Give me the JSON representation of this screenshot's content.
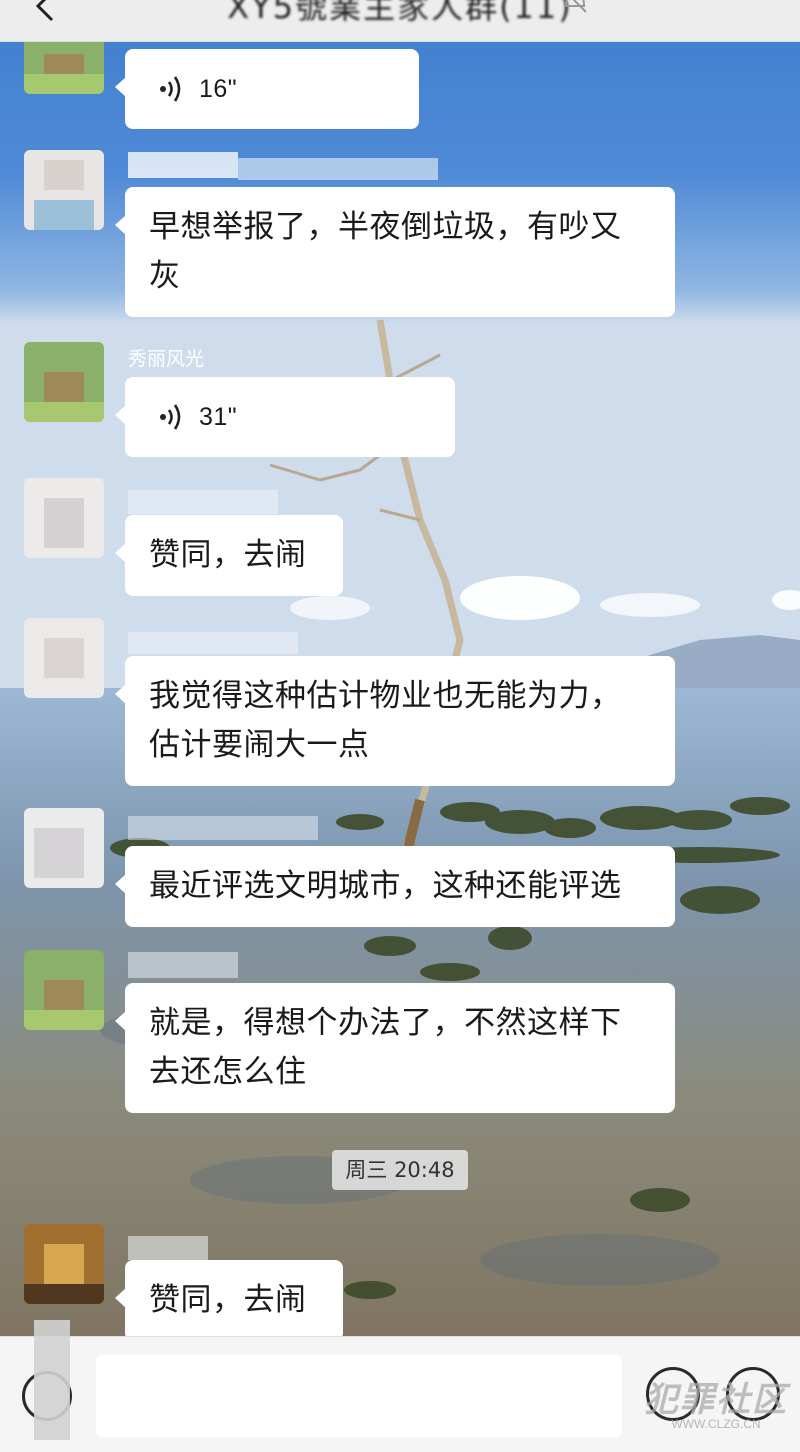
{
  "header": {
    "title": "XY5號業主家人群(11)",
    "back_icon": "chevron-left-icon",
    "mute_icon": "bell-off-icon"
  },
  "messages": [
    {
      "kind": "voice",
      "duration": "16\"",
      "nickname": ""
    },
    {
      "kind": "text",
      "nickname": "",
      "text_lines": [
        "早想举报了，半夜倒垃圾，有吵又",
        "灰"
      ]
    },
    {
      "kind": "voice",
      "duration": "31\"",
      "nickname": "秀丽风光"
    },
    {
      "kind": "text",
      "nickname": "",
      "text_lines": [
        "赞同，去闹"
      ]
    },
    {
      "kind": "text",
      "nickname": "",
      "text_lines": [
        "我觉得这种估计物业也无能为力，",
        "估计要闹大一点"
      ]
    },
    {
      "kind": "text",
      "nickname": "",
      "text_lines": [
        "最近评选文明城市，这种还能评选"
      ]
    },
    {
      "kind": "text",
      "nickname": "",
      "text_lines": [
        "就是，得想个办法了，不然这样下",
        "去还怎么住"
      ]
    },
    {
      "kind": "timestamp",
      "text": "周三 20:48"
    },
    {
      "kind": "text",
      "nickname": "",
      "text_lines": [
        "赞同，去闹"
      ]
    }
  ],
  "input_bar": {
    "voice_icon": "voice-toggle-icon",
    "emoji_icon": "emoji-icon",
    "plus_icon": "plus-icon",
    "placeholder": ""
  },
  "watermark": {
    "main": "犯罪社区",
    "sub": "WWW.CLZG.CN"
  },
  "colors": {
    "bubble": "#ffffff",
    "header_bg": "#ededed",
    "input_bar_bg": "#f5f5f5",
    "sky": "#5e92d4"
  }
}
